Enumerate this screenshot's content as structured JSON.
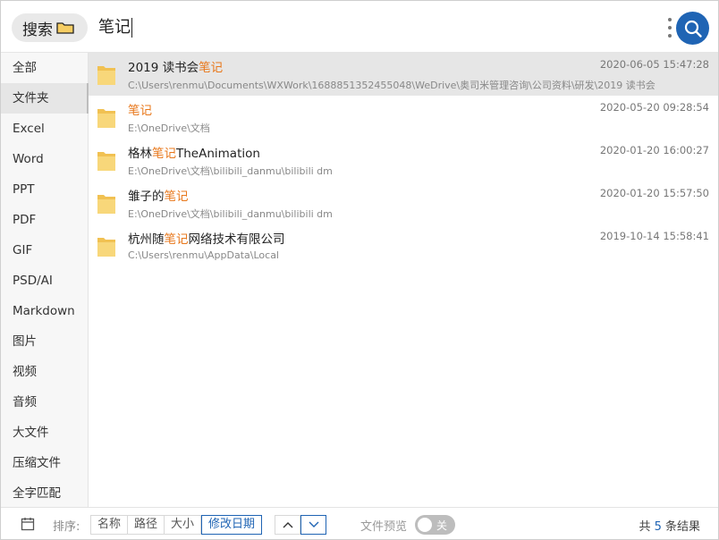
{
  "header": {
    "search_label": "搜索",
    "query": "笔记"
  },
  "sidebar": {
    "items": [
      {
        "label": "全部",
        "active": false
      },
      {
        "label": "文件夹",
        "active": true
      },
      {
        "label": "Excel",
        "active": false
      },
      {
        "label": "Word",
        "active": false
      },
      {
        "label": "PPT",
        "active": false
      },
      {
        "label": "PDF",
        "active": false
      },
      {
        "label": "GIF",
        "active": false
      },
      {
        "label": "PSD/AI",
        "active": false
      },
      {
        "label": "Markdown",
        "active": false
      },
      {
        "label": "图片",
        "active": false
      },
      {
        "label": "视频",
        "active": false
      },
      {
        "label": "音频",
        "active": false
      },
      {
        "label": "大文件",
        "active": false
      },
      {
        "label": "压缩文件",
        "active": false
      },
      {
        "label": "全字匹配",
        "active": false
      }
    ]
  },
  "results": [
    {
      "pre": "2019 读书会",
      "hl": "笔记",
      "post": "",
      "path": "C:\\Users\\renmu\\Documents\\WXWork\\1688851352455048\\WeDrive\\奥司米管理咨询\\公司资料\\研发\\2019 读书会",
      "time": "2020-06-05 15:47:28",
      "selected": true
    },
    {
      "pre": "",
      "hl": "笔记",
      "post": "",
      "path": "E:\\OneDrive\\文档",
      "time": "2020-05-20 09:28:54",
      "selected": false
    },
    {
      "pre": "格林",
      "hl": "笔记",
      "post": "TheAnimation",
      "path": "E:\\OneDrive\\文档\\bilibili_danmu\\bilibili dm",
      "time": "2020-01-20 16:00:27",
      "selected": false
    },
    {
      "pre": "雏子的",
      "hl": "笔记",
      "post": "",
      "path": "E:\\OneDrive\\文档\\bilibili_danmu\\bilibili dm",
      "time": "2020-01-20 15:57:50",
      "selected": false
    },
    {
      "pre": "杭州随",
      "hl": "笔记",
      "post": "网络技术有限公司",
      "path": "C:\\Users\\renmu\\AppData\\Local",
      "time": "2019-10-14 15:58:41",
      "selected": false
    }
  ],
  "footer": {
    "sort_label": "排序:",
    "sort_options": [
      {
        "label": "名称",
        "active": false
      },
      {
        "label": "路径",
        "active": false
      },
      {
        "label": "大小",
        "active": false
      },
      {
        "label": "修改日期",
        "active": true
      }
    ],
    "order": {
      "ascending_active": false,
      "descending_active": true
    },
    "preview_label": "文件预览",
    "preview_toggle_text": "关",
    "preview_enabled": false,
    "count_prefix": "共 ",
    "count_value": "5",
    "count_suffix": " 条结果"
  },
  "colors": {
    "accent": "#1f64b4",
    "highlight": "#e8781c",
    "folder": "#f6cd63"
  },
  "icons": {
    "pill": "folder-icon",
    "row": "folder-icon",
    "search": "magnifier-icon",
    "menu": "kebab-icon",
    "footer": "calendar-icon",
    "asc": "chevron-up-icon",
    "desc": "chevron-down-icon"
  }
}
